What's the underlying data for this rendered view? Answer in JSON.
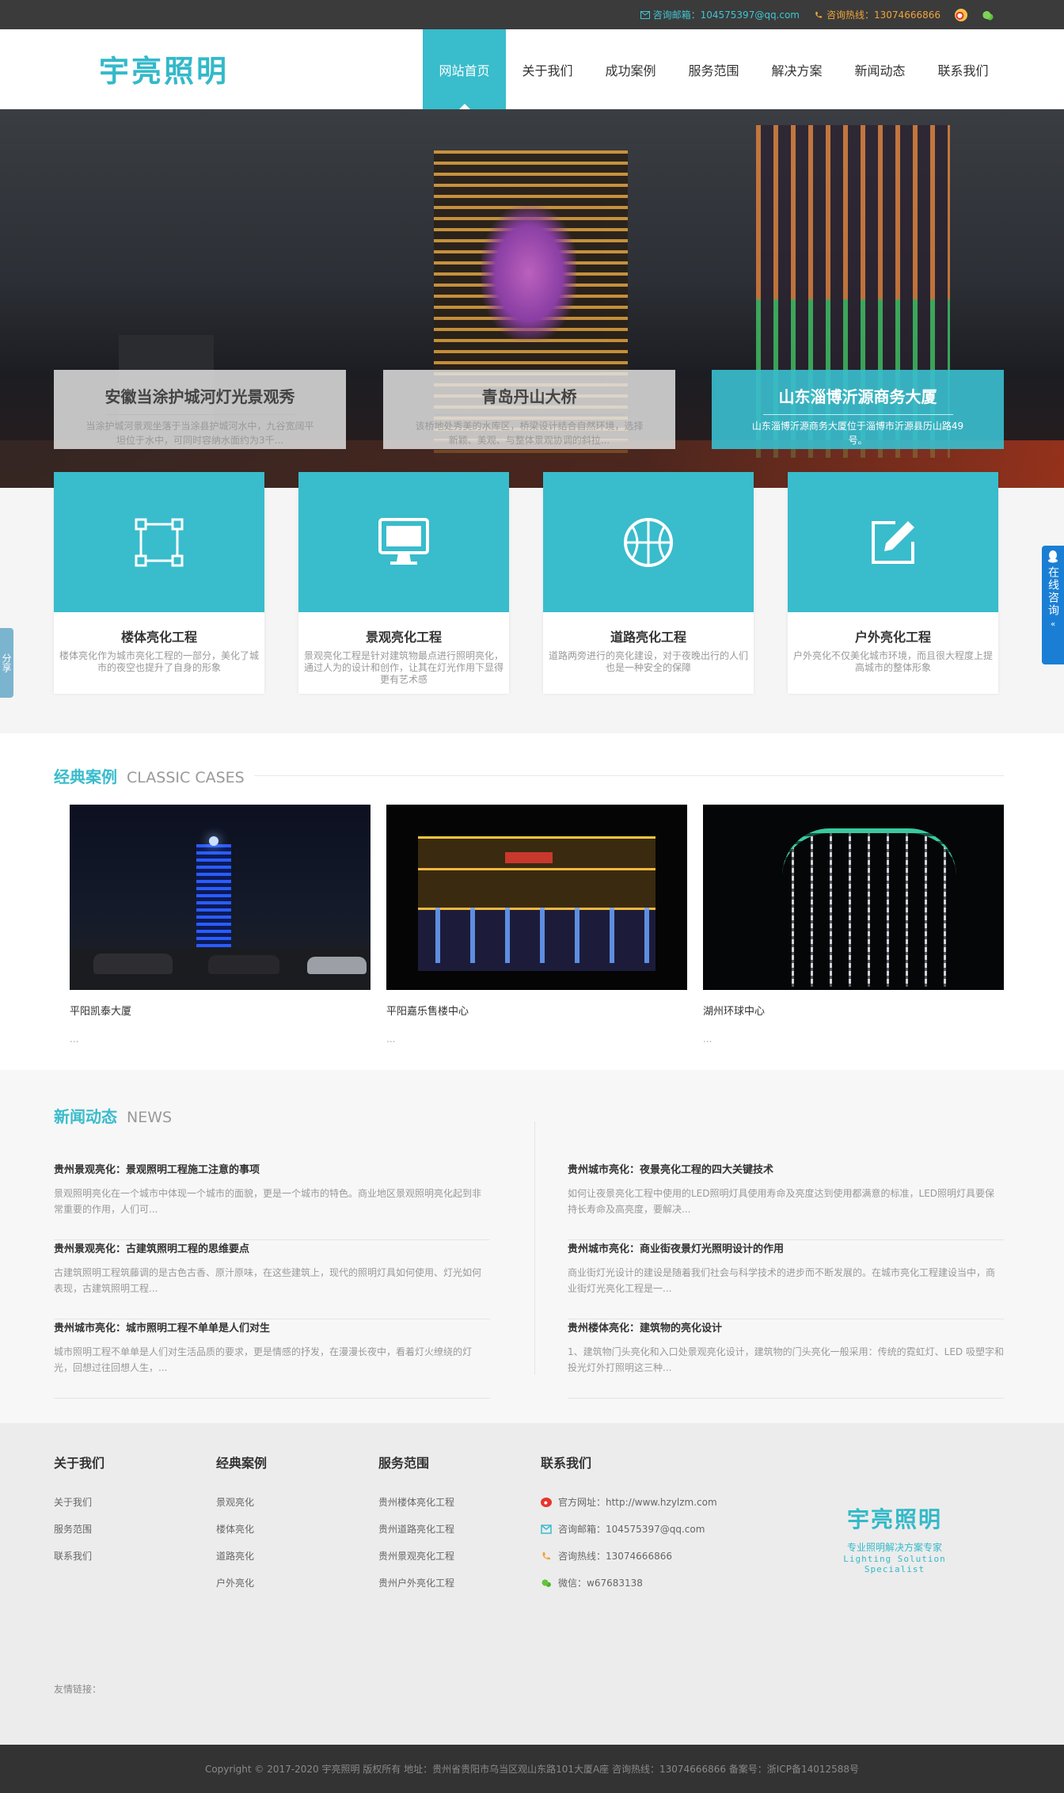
{
  "topbar": {
    "email": "咨询邮箱：104575397@qq.com",
    "phone": "咨询热线：13074666866",
    "colors": {
      "email": "#3ec7d3",
      "phone": "#f0a43a"
    }
  },
  "header": {
    "logo": "宇亮照明",
    "nav": [
      "网站首页",
      "关于我们",
      "成功案例",
      "服务范围",
      "解决方案",
      "新闻动态",
      "联系我们"
    ],
    "active_index": 0,
    "accent": "#39bccc"
  },
  "banner": {
    "captions": [
      {
        "title": "安徽当涂护城河灯光景观秀",
        "desc": "当涂护城河景观坐落于当涂县护城河水中，九谷宽阔平坦位于水中，可同时容纳水面约为3千..."
      },
      {
        "title": "青岛丹山大桥",
        "desc": "该桥地处秀美的水库区，桥梁设计结合自然环境，选择新颖、美观、与整体景观协调的斜拉..."
      },
      {
        "title": "山东淄博沂源商务大厦",
        "desc": "山东淄博沂源商务大厦位于淄博市沂源县历山路49号。"
      }
    ]
  },
  "services": [
    {
      "icon": "frame-select-icon",
      "title": "楼体亮化工程",
      "desc": "楼体亮化作为城市亮化工程的一部分，美化了城市的夜空也提升了自身的形象"
    },
    {
      "icon": "monitor-icon",
      "title": "景观亮化工程",
      "desc": "景观亮化工程是针对建筑物最点进行照明亮化，通过人为的设计和创作，让其在灯光作用下显得更有艺术感"
    },
    {
      "icon": "basketball-icon",
      "title": "道路亮化工程",
      "desc": "道路两旁进行的亮化建设，对于夜晚出行的人们也是一种安全的保障"
    },
    {
      "icon": "edit-icon",
      "title": "户外亮化工程",
      "desc": "户外亮化不仅美化城市环境，而且很大程度上提高城市的整体形象"
    }
  ],
  "sidebar": {
    "share": "分享",
    "qq": "在线咨询"
  },
  "cases": {
    "title_cn": "经典案例",
    "title_en": "CLASSIC CASES",
    "items": [
      {
        "name": "平阳凯泰大厦",
        "more": "..."
      },
      {
        "name": "平阳嘉乐售楼中心",
        "more": "..."
      },
      {
        "name": "湖州环球中心",
        "more": "..."
      }
    ]
  },
  "news": {
    "title_cn": "新闻动态",
    "title_en": "NEWS",
    "left": [
      {
        "title": "贵州景观亮化：景观照明工程施工注意的事项",
        "desc": "景观照明亮化在一个城市中体现一个城市的面貌，更是一个城市的特色。商业地区景观照明亮化起到非常重要的作用，人们可..."
      },
      {
        "title": "贵州景观亮化：古建筑照明工程的思维要点",
        "desc": "古建筑照明工程筑藤调的是古色古香、原汁原味，在这些建筑上，现代的照明灯具如何使用、灯光如何表现，古建筑照明工程..."
      },
      {
        "title": "贵州城市亮化：城市照明工程不单单是人们对生",
        "desc": "城市照明工程不单单是人们对生活品质的要求，更是情感的抒发，在漫漫长夜中，看着灯火缭绕的灯光，回想过往回想人生，..."
      }
    ],
    "right": [
      {
        "title": "贵州城市亮化：夜景亮化工程的四大关键技术",
        "desc": "如何让夜景亮化工程中使用的LED照明灯具使用寿命及亮度达到使用都满意的标准，LED照明灯具要保持长寿命及高亮度，要解决..."
      },
      {
        "title": "贵州城市亮化：商业街夜景灯光照明设计的作用",
        "desc": "商业街灯光设计的建设是随着我们社会与科学技术的进步而不断发展的。在城市亮化工程建设当中，商业街灯光亮化工程是一..."
      },
      {
        "title": "贵州楼体亮化：建筑物的亮化设计",
        "desc": "1、建筑物门头亮化和入口处景观亮化设计，建筑物的门头亮化一般采用：传统的霓虹灯、LED 吸塑字和投光灯外打照明这三种..."
      }
    ]
  },
  "footer": {
    "about": {
      "title": "关于我们",
      "links": [
        "关于我们",
        "服务范围",
        "联系我们"
      ]
    },
    "cases": {
      "title": "经典案例",
      "links": [
        "景观亮化",
        "楼体亮化",
        "道路亮化",
        "户外亮化"
      ]
    },
    "scope": {
      "title": "服务范围",
      "links": [
        "贵州楼体亮化工程",
        "贵州道路亮化工程",
        "贵州景观亮化工程",
        "贵州户外亮化工程"
      ]
    },
    "contact": {
      "title": "联系我们",
      "items": [
        {
          "icon": "weibo-icon",
          "text": "官方网址：http://www.hzylzm.com"
        },
        {
          "icon": "mail-icon",
          "text": "咨询邮箱：104575397@qq.com"
        },
        {
          "icon": "phone-icon",
          "text": "咨询热线：13074666866"
        },
        {
          "icon": "wechat-icon",
          "text": "微信：w67683138"
        }
      ]
    },
    "logo": {
      "name": "宇亮照明",
      "slogan": "专业照明解决方案专家",
      "slogan_en": "Lighting Solution Specialist"
    },
    "friend_links": "友情链接："
  },
  "copyright": "Copyright © 2017-2020 宇亮照明 版权所有    地址：贵州省贵阳市乌当区观山东路101大厦A座    咨询热线：13074666866    备案号：浙ICP备14012588号"
}
